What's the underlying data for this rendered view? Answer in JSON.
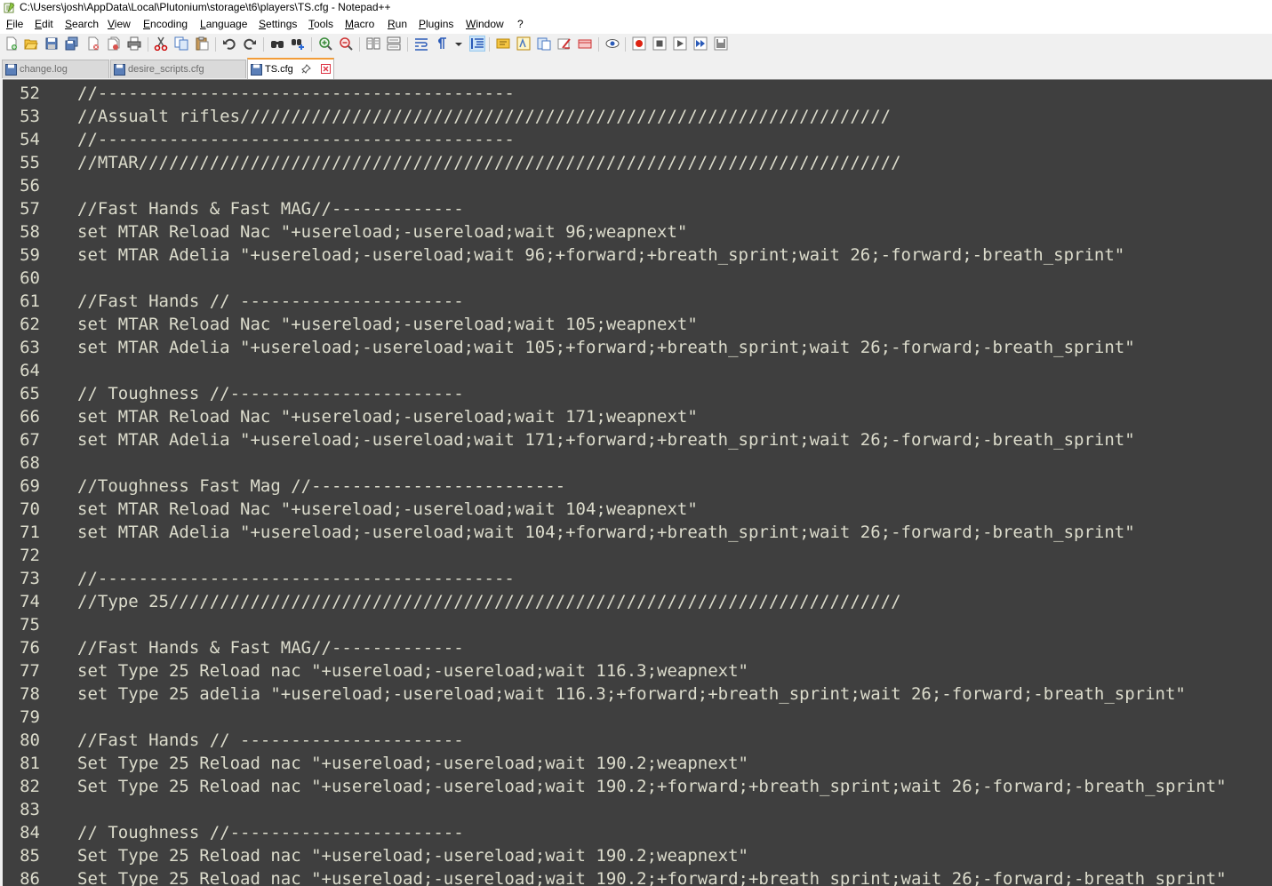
{
  "window": {
    "title": "C:\\Users\\josh\\AppData\\Local\\Plutonium\\storage\\t6\\players\\TS.cfg - Notepad++"
  },
  "menu": [
    "File",
    "Edit",
    "Search",
    "View",
    "Encoding",
    "Language",
    "Settings",
    "Tools",
    "Macro",
    "Run",
    "Plugins",
    "Window",
    "?"
  ],
  "tabs": [
    {
      "label": "change.log",
      "active": false
    },
    {
      "label": "desire_scripts.cfg",
      "active": false
    },
    {
      "label": "TS.cfg",
      "active": true
    }
  ],
  "editor": {
    "lines": [
      {
        "n": "52",
        "text": "//-----------------------------------------"
      },
      {
        "n": "53",
        "text": "//Assualt rifles////////////////////////////////////////////////////////////////"
      },
      {
        "n": "54",
        "text": "//-----------------------------------------"
      },
      {
        "n": "55",
        "text": "//MTAR///////////////////////////////////////////////////////////////////////////"
      },
      {
        "n": "56",
        "text": ""
      },
      {
        "n": "57",
        "text": "//Fast Hands & Fast MAG//-------------"
      },
      {
        "n": "58",
        "text": "set MTAR Reload Nac \"+usereload;-usereload;wait 96;weapnext\""
      },
      {
        "n": "59",
        "text": "set MTAR Adelia \"+usereload;-usereload;wait 96;+forward;+breath_sprint;wait 26;-forward;-breath_sprint\""
      },
      {
        "n": "60",
        "text": ""
      },
      {
        "n": "61",
        "text": "//Fast Hands // ----------------------"
      },
      {
        "n": "62",
        "text": "set MTAR Reload Nac \"+usereload;-usereload;wait 105;weapnext\""
      },
      {
        "n": "63",
        "text": "set MTAR Adelia \"+usereload;-usereload;wait 105;+forward;+breath_sprint;wait 26;-forward;-breath_sprint\""
      },
      {
        "n": "64",
        "text": ""
      },
      {
        "n": "65",
        "text": "// Toughness //-----------------------"
      },
      {
        "n": "66",
        "text": "set MTAR Reload Nac \"+usereload;-usereload;wait 171;weapnext\""
      },
      {
        "n": "67",
        "text": "set MTAR Adelia \"+usereload;-usereload;wait 171;+forward;+breath_sprint;wait 26;-forward;-breath_sprint\""
      },
      {
        "n": "68",
        "text": ""
      },
      {
        "n": "69",
        "text": "//Toughness Fast Mag //-------------------------"
      },
      {
        "n": "70",
        "text": "set MTAR Reload Nac \"+usereload;-usereload;wait 104;weapnext\""
      },
      {
        "n": "71",
        "text": "set MTAR Adelia \"+usereload;-usereload;wait 104;+forward;+breath_sprint;wait 26;-forward;-breath_sprint\""
      },
      {
        "n": "72",
        "text": ""
      },
      {
        "n": "73",
        "text": "//-----------------------------------------"
      },
      {
        "n": "74",
        "text": "//Type 25////////////////////////////////////////////////////////////////////////"
      },
      {
        "n": "75",
        "text": ""
      },
      {
        "n": "76",
        "text": "//Fast Hands & Fast MAG//-------------"
      },
      {
        "n": "77",
        "text": "set Type 25 Reload nac \"+usereload;-usereload;wait 116.3;weapnext\""
      },
      {
        "n": "78",
        "text": "set Type 25 adelia \"+usereload;-usereload;wait 116.3;+forward;+breath_sprint;wait 26;-forward;-breath_sprint\""
      },
      {
        "n": "79",
        "text": ""
      },
      {
        "n": "80",
        "text": "//Fast Hands // ----------------------"
      },
      {
        "n": "81",
        "text": "Set Type 25 Reload nac \"+usereload;-usereload;wait 190.2;weapnext\""
      },
      {
        "n": "82",
        "text": "Set Type 25 Reload nac \"+usereload;-usereload;wait 190.2;+forward;+breath_sprint;wait 26;-forward;-breath_sprint\""
      },
      {
        "n": "83",
        "text": ""
      },
      {
        "n": "84",
        "text": "// Toughness //-----------------------"
      },
      {
        "n": "85",
        "text": "Set Type 25 Reload nac \"+usereload;-usereload;wait 190.2;weapnext\""
      },
      {
        "n": "86",
        "text": "Set Type 25 Reload nac \"+usereload;-usereload;wait 190.2;+forward;+breath_sprint;wait 26;-forward;-breath_sprint\""
      }
    ]
  },
  "toolbar": [
    {
      "icon": "new-file-icon"
    },
    {
      "icon": "open-file-icon"
    },
    {
      "icon": "save-icon"
    },
    {
      "icon": "save-all-icon"
    },
    {
      "icon": "close-icon"
    },
    {
      "icon": "close-all-icon"
    },
    {
      "icon": "print-icon"
    },
    {
      "icon": "cut-icon"
    },
    {
      "icon": "copy-icon"
    },
    {
      "icon": "paste-icon"
    },
    {
      "icon": "undo-icon"
    },
    {
      "icon": "redo-icon"
    },
    {
      "icon": "find-icon"
    },
    {
      "icon": "replace-icon"
    },
    {
      "icon": "zoom-in-icon"
    },
    {
      "icon": "zoom-out-icon"
    },
    {
      "icon": "sync-vertical-icon"
    },
    {
      "icon": "sync-horizontal-icon"
    },
    {
      "icon": "word-wrap-icon"
    },
    {
      "icon": "show-all-characters-icon"
    },
    {
      "icon": "dropdown-icon"
    },
    {
      "icon": "indent-guide-icon"
    },
    {
      "icon": "language-icon"
    },
    {
      "icon": "document-map-icon"
    },
    {
      "icon": "function-list-icon"
    },
    {
      "icon": "folder-as-workspace-icon"
    },
    {
      "icon": "monitoring-icon"
    },
    {
      "icon": "preview-icon"
    },
    {
      "icon": "record-macro-icon"
    },
    {
      "icon": "stop-macro-icon"
    },
    {
      "icon": "play-macro-icon"
    },
    {
      "icon": "run-macro-multiple-icon"
    },
    {
      "icon": "save-macro-icon"
    }
  ]
}
